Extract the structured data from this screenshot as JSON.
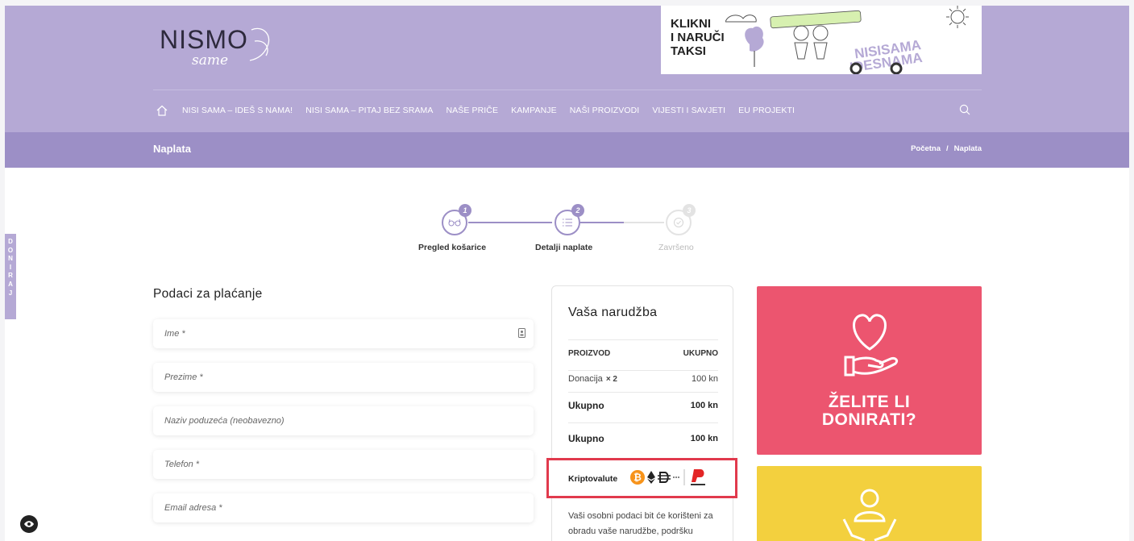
{
  "header": {
    "logo_main": "NISMO",
    "logo_sub": "same",
    "banner_text": "KLIKNI\nI NARUČI\nTAKSI",
    "nav": [
      "NISI SAMA – IDEŠ S NAMA!",
      "NISI SAMA – PITAJ BEZ SRAMA",
      "NAŠE PRIČE",
      "KAMPANJE",
      "NAŠI PROIZVODI",
      "VIJESTI I SAVJETI",
      "EU PROJEKTI"
    ]
  },
  "breadcrumb": {
    "title": "Naplata",
    "home": "Početna",
    "separator": "/",
    "current": "Naplata"
  },
  "side_tab": [
    "D",
    "O",
    "N",
    "I",
    "R",
    "A",
    "J"
  ],
  "steps": [
    {
      "num": "1",
      "label": "Pregled košarice",
      "active": true
    },
    {
      "num": "2",
      "label": "Detalji naplate",
      "active": true
    },
    {
      "num": "3",
      "label": "Završeno",
      "active": false
    }
  ],
  "form": {
    "title": "Podaci za plaćanje",
    "fields": [
      {
        "placeholder": "Ime *"
      },
      {
        "placeholder": "Prezime *"
      },
      {
        "placeholder": "Naziv poduzeća (neobavezno)"
      },
      {
        "placeholder": "Telefon *"
      },
      {
        "placeholder": "Email adresa *"
      }
    ]
  },
  "order": {
    "title": "Vaša narudžba",
    "col_product": "PROIZVOD",
    "col_total": "UKUPNO",
    "item_name": "Donacija",
    "item_qty": "× 2",
    "item_amount": "100 kn",
    "subtotal_label": "Ukupno",
    "subtotal_amount": "100 kn",
    "total_label": "Ukupno",
    "total_amount": "100 kn",
    "crypto_label": "Kriptovalute",
    "note": "Vaši osobni podaci bit će korišteni za obradu vaše narudžbe, podršku"
  },
  "promo": {
    "pink_text_1": "ŽELITE LI",
    "pink_text_2": "DONIRATI?"
  },
  "colors": {
    "header_bg": "#b5a9d5",
    "crumb_bg": "#9c8fc6",
    "pink": "#ec556f",
    "yellow": "#f3d03e",
    "highlight": "#e13a4d"
  }
}
